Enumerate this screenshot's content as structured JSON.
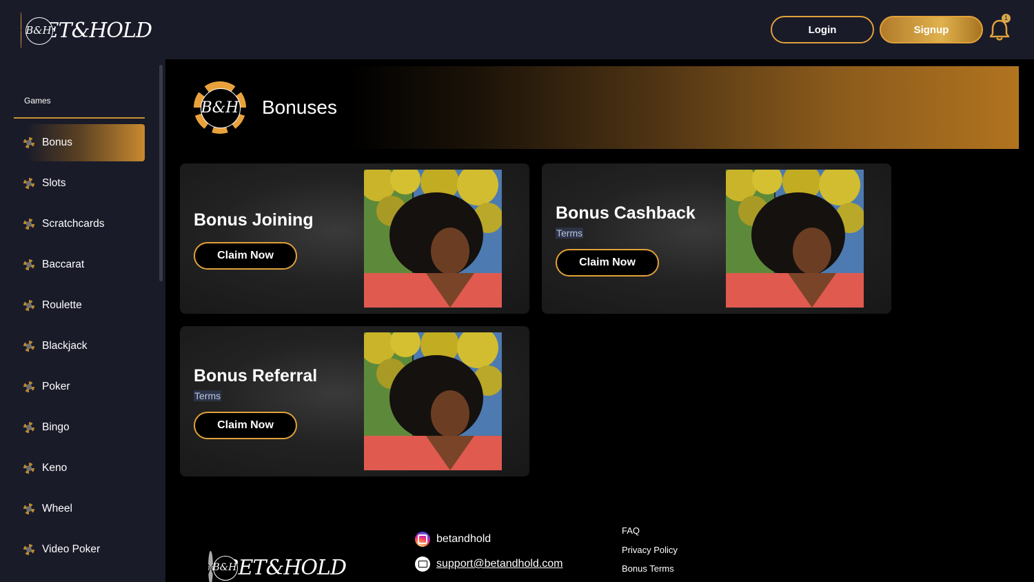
{
  "brand": {
    "monogram": "B&H",
    "wordmark": "BET&HOLD"
  },
  "header": {
    "login_label": "Login",
    "signup_label": "Signup",
    "notification_count": "1"
  },
  "sidebar": {
    "section_label": "Games",
    "items": [
      {
        "label": "Bonus",
        "active": true
      },
      {
        "label": "Slots"
      },
      {
        "label": "Scratchcards"
      },
      {
        "label": "Baccarat"
      },
      {
        "label": "Roulette"
      },
      {
        "label": "Blackjack"
      },
      {
        "label": "Poker"
      },
      {
        "label": "Bingo"
      },
      {
        "label": "Keno"
      },
      {
        "label": "Wheel"
      },
      {
        "label": "Video Poker"
      }
    ]
  },
  "page": {
    "title": "Bonuses"
  },
  "bonuses": [
    {
      "title": "Bonus Joining",
      "claim_label": "Claim Now"
    },
    {
      "title": "Bonus Cashback",
      "terms_label": "Terms",
      "claim_label": "Claim Now"
    },
    {
      "title": "Bonus Referral",
      "terms_label": "Terms",
      "claim_label": "Claim Now"
    }
  ],
  "footer": {
    "instagram": "betandhold",
    "email": "support@betandhold.com",
    "links": [
      "FAQ",
      "Privacy Policy",
      "Bonus Terms"
    ]
  },
  "colors": {
    "accent": "#e2a23a",
    "header_bg": "#1a1b29",
    "page_bg": "#000000"
  }
}
